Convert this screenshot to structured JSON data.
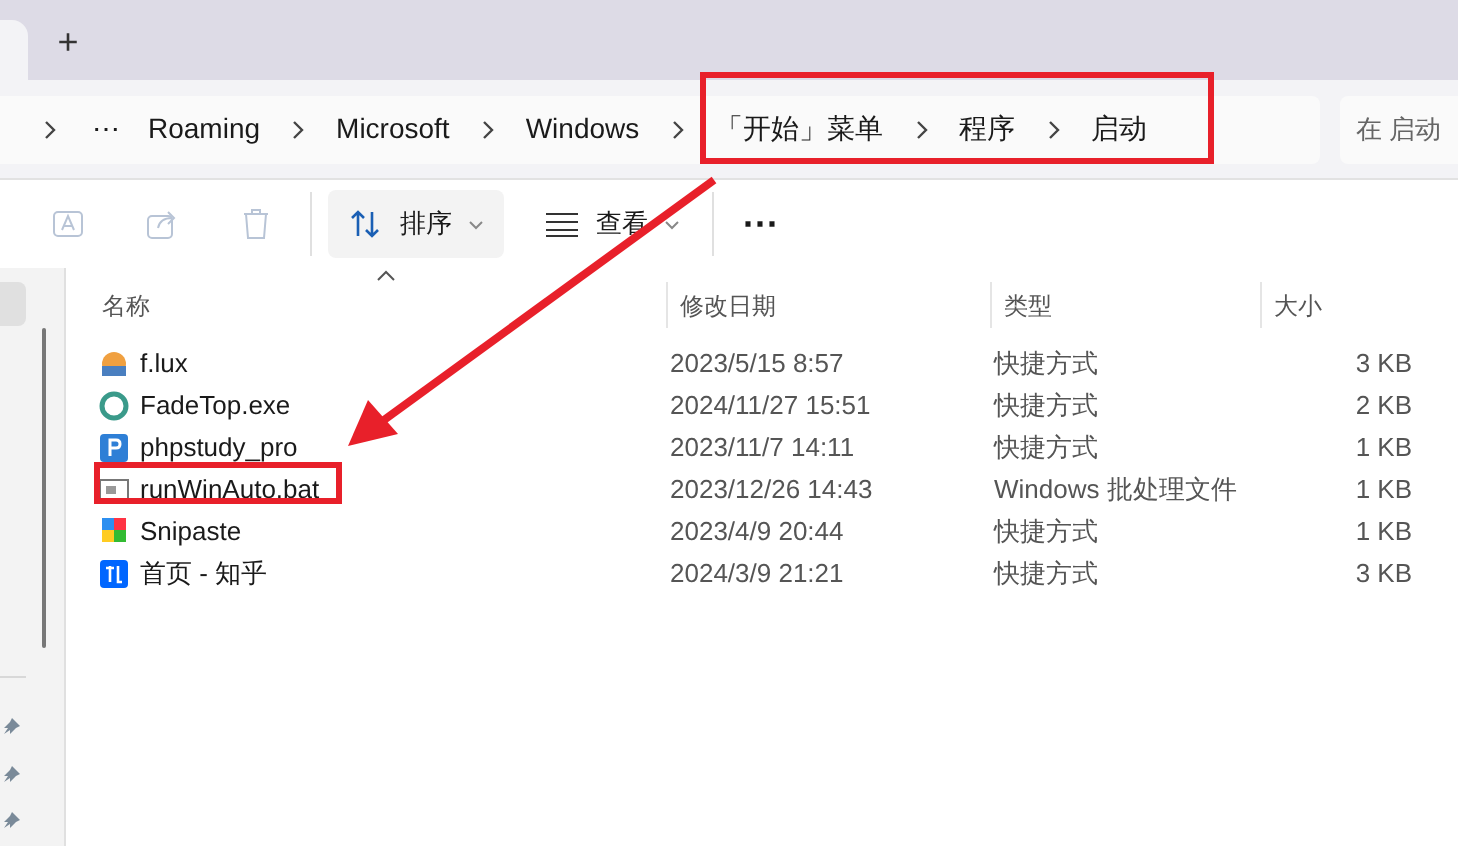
{
  "tab_strip": {
    "new_tab": "+"
  },
  "breadcrumb": {
    "overflow": "⋯",
    "items": [
      "Roaming",
      "Microsoft",
      "Windows",
      "「开始」菜单",
      "程序",
      "启动"
    ]
  },
  "search": {
    "placeholder": "在 启动"
  },
  "toolbar": {
    "actions": [
      {
        "kind": "rename",
        "disabled": true
      },
      {
        "kind": "share",
        "disabled": true
      },
      {
        "kind": "delete",
        "disabled": true
      }
    ],
    "sort": "排序",
    "view": "查看",
    "more": "⋯"
  },
  "table": {
    "columns": [
      "名称",
      "修改日期",
      "类型",
      "大小"
    ],
    "rows": [
      {
        "name": "f.lux",
        "modified": "2023/5/15 8:57",
        "type": "快捷方式",
        "size": "3 KB"
      },
      {
        "name": "FadeTop.exe",
        "modified": "2024/11/27 15:51",
        "type": "快捷方式",
        "size": "2 KB"
      },
      {
        "name": "phpstudy_pro",
        "modified": "2023/11/7 14:11",
        "type": "快捷方式",
        "size": "1 KB"
      },
      {
        "name": "runWinAuto.bat",
        "modified": "2023/12/26 14:43",
        "type": "Windows 批处理文件",
        "size": "1 KB"
      },
      {
        "name": "Snipaste",
        "modified": "2023/4/9 20:44",
        "type": "快捷方式",
        "size": "1 KB"
      },
      {
        "name": "首页 - 知乎",
        "modified": "2024/3/9 21:21",
        "type": "快捷方式",
        "size": "3 KB"
      }
    ]
  }
}
